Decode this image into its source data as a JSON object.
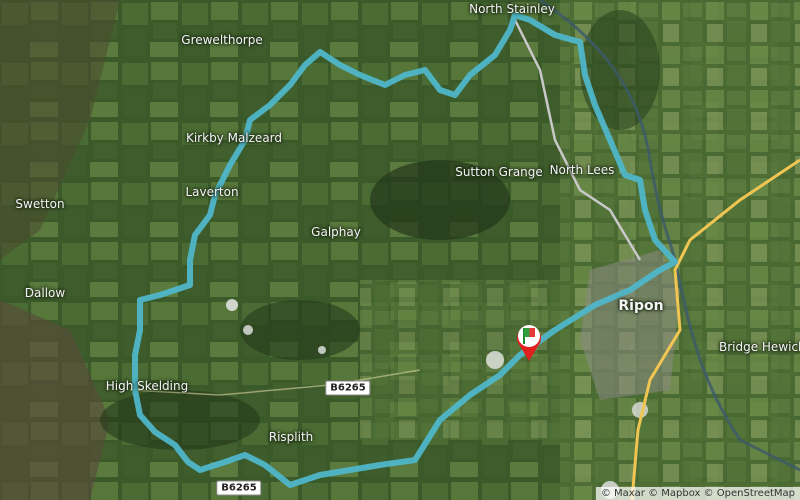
{
  "map": {
    "places": [
      {
        "id": "north-stainley",
        "label": "North Stainley"
      },
      {
        "id": "grewelthorpe",
        "label": "Grewelthorpe"
      },
      {
        "id": "kirkby-malzeard",
        "label": "Kirkby Malzeard"
      },
      {
        "id": "laverton",
        "label": "Laverton"
      },
      {
        "id": "swetton",
        "label": "Swetton"
      },
      {
        "id": "sutton-grange",
        "label": "Sutton Grange"
      },
      {
        "id": "north-lees",
        "label": "North Lees"
      },
      {
        "id": "galphay",
        "label": "Galphay"
      },
      {
        "id": "dallow",
        "label": "Dallow"
      },
      {
        "id": "ripon",
        "label": "Ripon"
      },
      {
        "id": "bridge-hewick",
        "label": "Bridge Hewick"
      },
      {
        "id": "high-skelding",
        "label": "High Skelding"
      },
      {
        "id": "risplith",
        "label": "Risplith"
      }
    ],
    "roads": [
      {
        "id": "b6265-mid",
        "label": "B6265"
      },
      {
        "id": "b6265-low",
        "label": "B6265"
      }
    ],
    "attribution": "© Maxar © Mapbox © OpenStreetMap",
    "route_color": "#4fb6c9",
    "start_flag": "flag-icon"
  }
}
